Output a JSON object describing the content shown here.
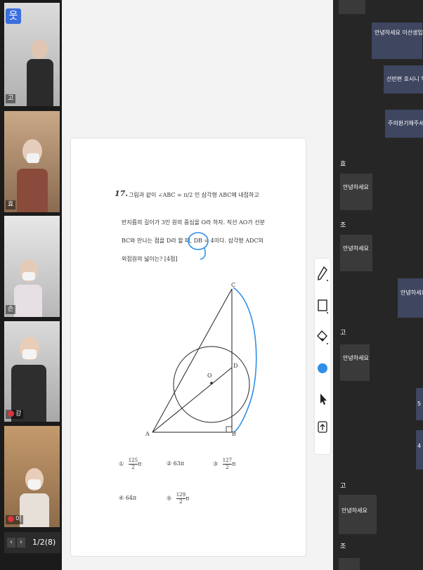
{
  "video": {
    "tiles": [
      {
        "name_tag": "고"
      },
      {
        "name_tag": "효"
      },
      {
        "name_tag": "손"
      },
      {
        "name_tag": "강"
      },
      {
        "name_tag": "이"
      }
    ],
    "page_indicator": "1/2(8)",
    "prev_symbol": "‹",
    "next_symbol": "›"
  },
  "question": {
    "number": "17.",
    "line1": "그림과 같이 ∠ABC = π/2 인 삼각형 ABC에 내접하고",
    "line2": "반지름의 길이가 3인 원의 중심을 O라 하자. 직선 AO가 선분",
    "line3": "BC와 만나는 점을 D라 할 때, DB = 4이다. 삼각형 ADC의",
    "line4": "외접원의 넓이는? [4점]",
    "choices": [
      {
        "num": "①",
        "val": "125",
        "den": "2",
        "suffix": "π"
      },
      {
        "num": "②",
        "val": "63π"
      },
      {
        "num": "③",
        "val": "127",
        "den": "2",
        "suffix": "π"
      },
      {
        "num": "④",
        "val": "64π"
      },
      {
        "num": "⑤",
        "val": "129",
        "den": "2",
        "suffix": "π"
      }
    ],
    "figure_labels": {
      "A": "A",
      "B": "B",
      "C": "C",
      "D": "D",
      "O": "O"
    }
  },
  "toolbar": {
    "icons": [
      "pen-icon",
      "rectangle-icon",
      "eraser-icon",
      "color-icon",
      "pointer-icon",
      "upload-icon"
    ],
    "accent": "#2f8fe8"
  },
  "chat": {
    "messages": [
      {
        "side": "mine",
        "text": "안녕하세요 이선생입니다."
      },
      {
        "side": "mine",
        "text": "선반편 호시니 학생"
      },
      {
        "side": "mine",
        "text": "주의환기해주세요"
      },
      {
        "side": "other",
        "sender": "효",
        "text": "안녕하세요"
      },
      {
        "side": "other",
        "sender": "조",
        "text": "안녕하세요"
      },
      {
        "side": "mine",
        "text": "안녕하세요 (안"
      },
      {
        "side": "other",
        "sender": "고",
        "text": "안녕하세요"
      },
      {
        "side": "mine",
        "text": "5"
      },
      {
        "side": "mine",
        "text": "4"
      },
      {
        "side": "other",
        "sender": "고",
        "text": "안녕하세요"
      },
      {
        "side": "other",
        "sender": "조",
        "text": ""
      }
    ]
  },
  "colors": {
    "annotation": "#2f8fe8",
    "chat_bg": "#262626",
    "mine_bubble": "#3e4660"
  }
}
